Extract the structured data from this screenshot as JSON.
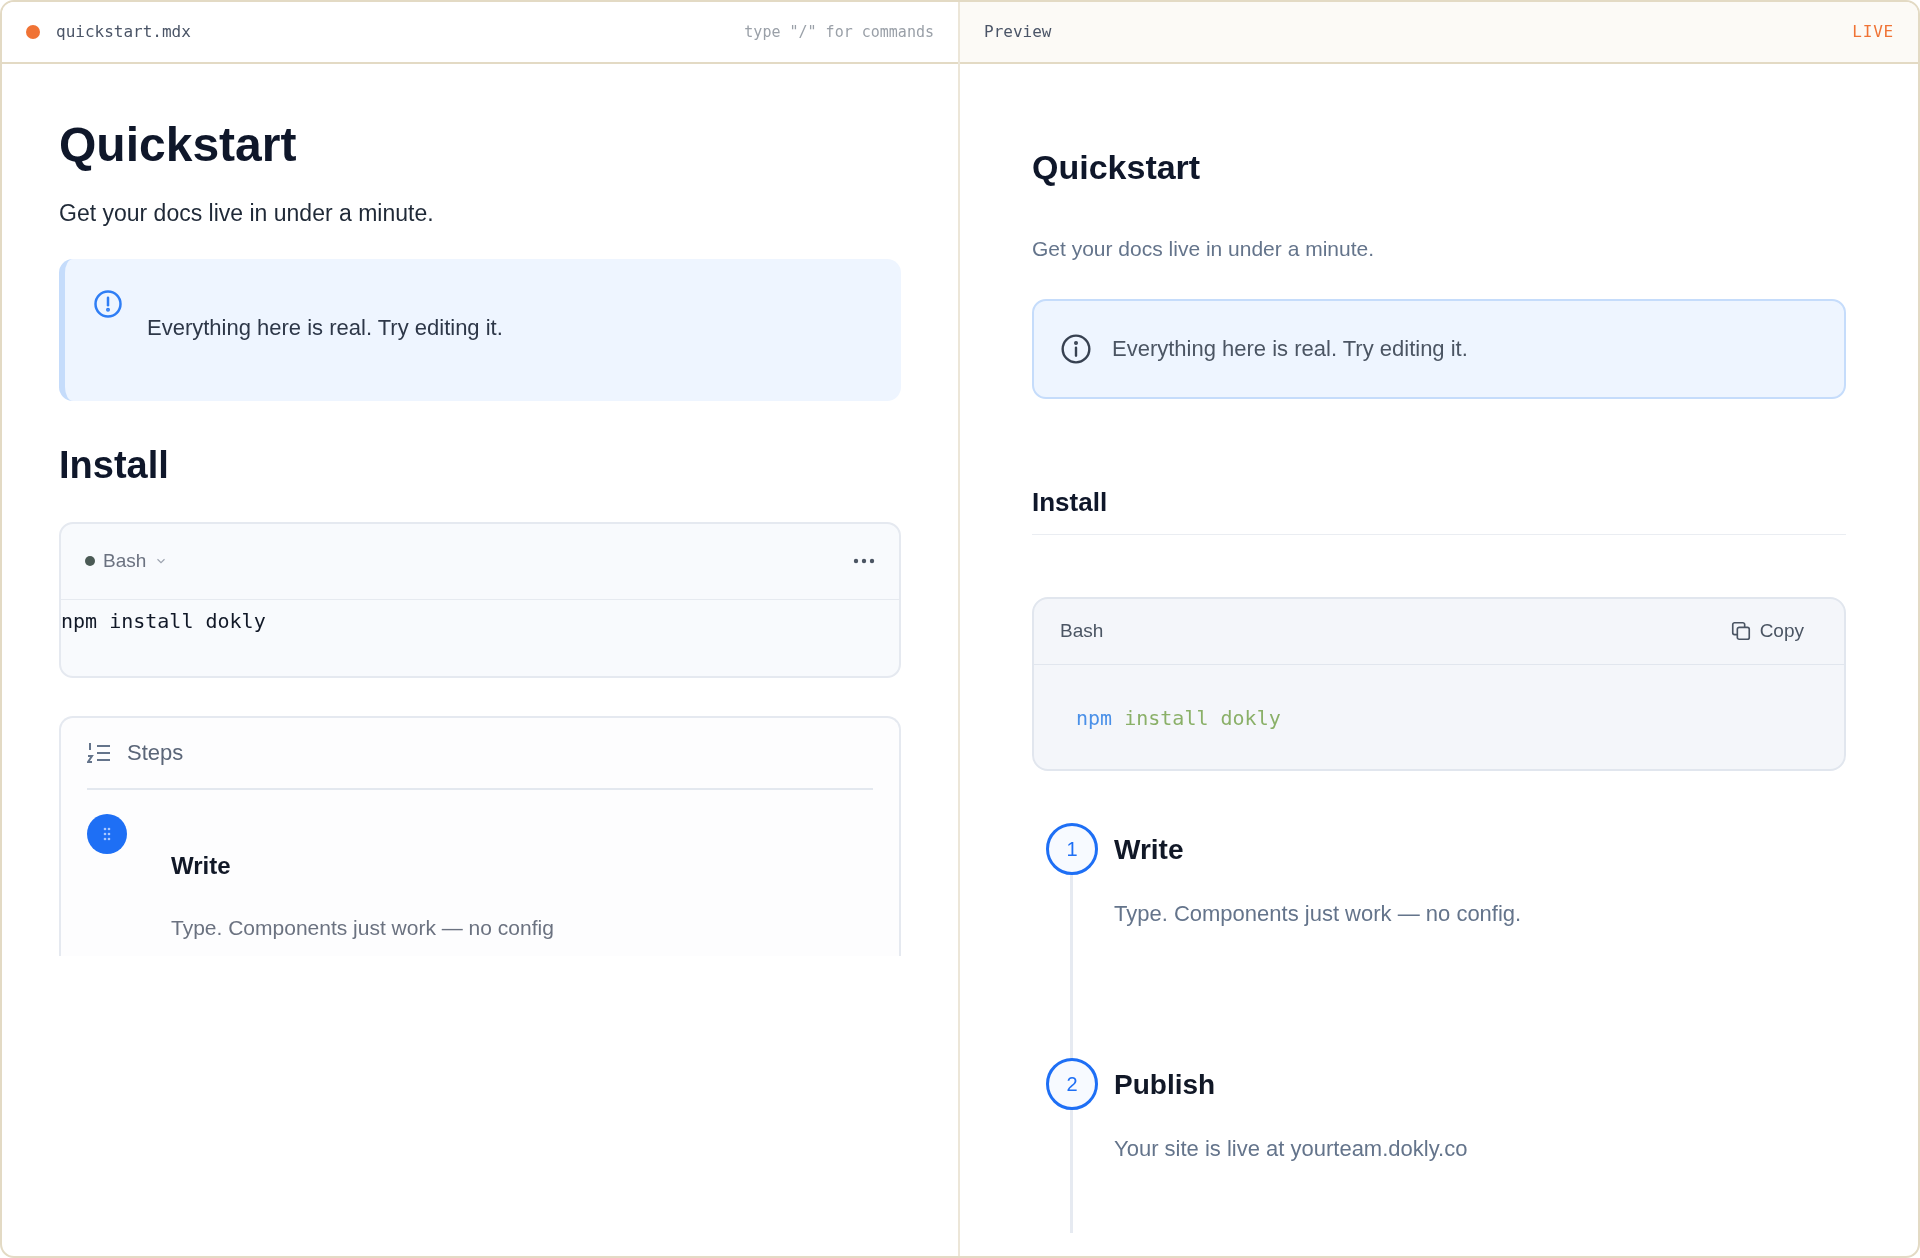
{
  "editor": {
    "file_name": "quickstart.mdx",
    "hint": "type \"/\" for commands",
    "title": "Quickstart",
    "subtitle": "Get your docs live in under a minute.",
    "callout": "Everything here is real. Try editing it.",
    "heading": "Install",
    "code_block": {
      "language": "Bash",
      "code": "npm install dokly"
    },
    "steps_block": {
      "label": "Steps",
      "steps": [
        {
          "title": "Write",
          "body": "Type. Components just work — no config"
        }
      ]
    }
  },
  "preview": {
    "label": "Preview",
    "badge": "LIVE",
    "title": "Quickstart",
    "subtitle": "Get your docs live in under a minute.",
    "callout": "Everything here is real. Try editing it.",
    "heading": "Install",
    "code_block": {
      "language": "Bash",
      "copy_label": "Copy",
      "tokens": [
        {
          "text": "npm",
          "kind": "command"
        },
        {
          "text": "install",
          "kind": "argument"
        },
        {
          "text": "dokly",
          "kind": "argument"
        }
      ]
    },
    "steps": [
      {
        "number": "1",
        "title": "Write",
        "body": "Type. Components just work — no config."
      },
      {
        "number": "2",
        "title": "Publish",
        "body": "Your site is live at yourteam.dokly.co"
      }
    ]
  }
}
